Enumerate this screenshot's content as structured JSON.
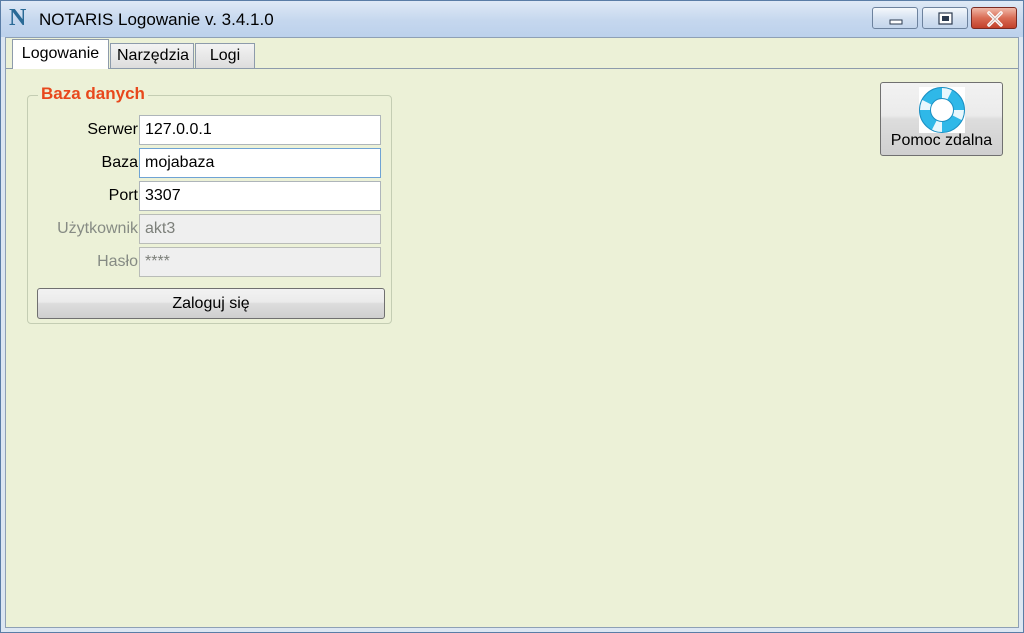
{
  "window": {
    "title": "NOTARIS Logowanie v. 3.4.1.0",
    "icon": "notaris-n-icon",
    "controls": [
      "minimize",
      "maximize",
      "close"
    ]
  },
  "tabs": [
    {
      "label": "Logowanie",
      "active": true
    },
    {
      "label": "Narzędzia",
      "active": false
    },
    {
      "label": "Logi",
      "active": false
    }
  ],
  "database": {
    "group_title": "Baza danych",
    "fields": [
      {
        "label": "Serwer",
        "value": "127.0.0.1",
        "enabled": true
      },
      {
        "label": "Baza",
        "value": "mojabaza",
        "enabled": true,
        "focused": true
      },
      {
        "label": "Port",
        "value": "3307",
        "enabled": true
      },
      {
        "label": "Użytkownik",
        "value": "akt3",
        "enabled": false
      },
      {
        "label": "Hasło",
        "value": "****",
        "enabled": false
      }
    ],
    "login_button": "Zaloguj się"
  },
  "remote_help": {
    "label": "Pomoc zdalna",
    "icon": "lifebuoy-icon"
  },
  "colors": {
    "background": "#ecf1d7",
    "group_title": "#e8481c",
    "titlebar": "#c5d7ee"
  }
}
